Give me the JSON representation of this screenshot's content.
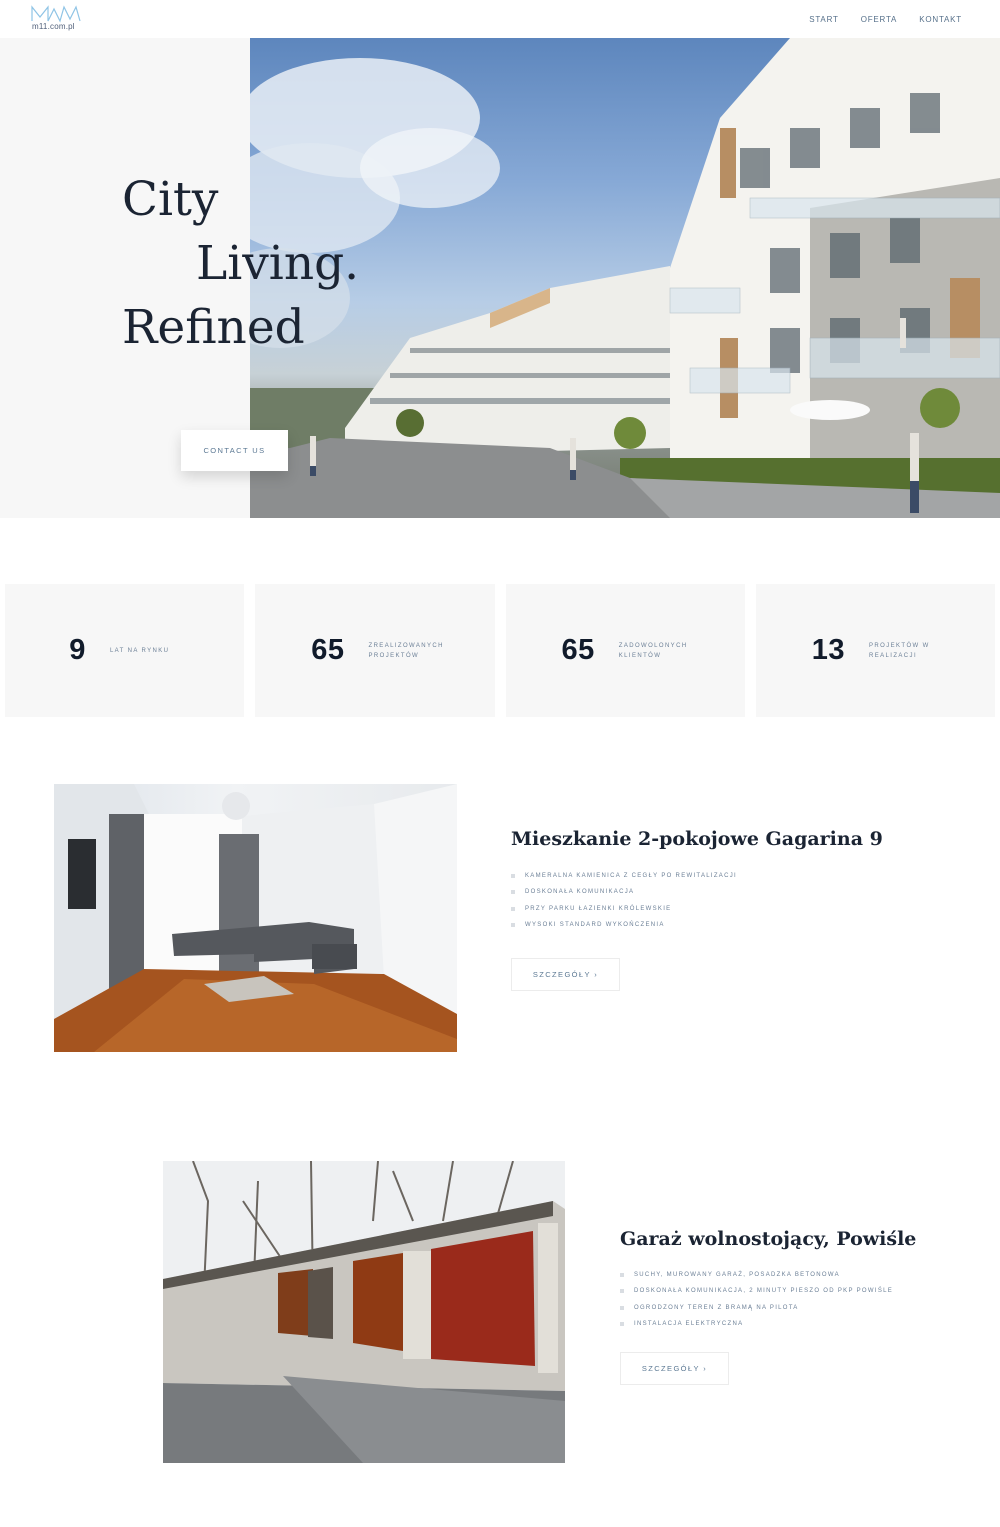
{
  "nav": {
    "logo_text": "m11.com.pl",
    "links": [
      "START",
      "OFERTA",
      "KONTAKT"
    ]
  },
  "hero": {
    "title_line1": "City",
    "title_line2": "Living.",
    "title_line3": "Refined",
    "cta_label": "CONTACT US"
  },
  "stats": [
    {
      "number": "9",
      "label": "LAT NA RYNKU"
    },
    {
      "number": "65",
      "label": "ZREALIZOWANYCH PROJEKTÓW"
    },
    {
      "number": "65",
      "label": "ZADOWOLONYCH KLIENTÓW"
    },
    {
      "number": "13",
      "label": "PROJEKTÓW W REALIZACJI"
    }
  ],
  "offers": [
    {
      "title": "Mieszkanie 2-pokojowe Gagarina 9",
      "features": [
        "KAMERALNA KAMIENICA Z CEGŁY PO REWITALIZACJI",
        "DOSKONAŁA KOMUNIKACJA",
        "PRZY PARKU ŁAZIENKI KRÓLEWSKIE",
        "WYSOKI STANDARD WYKOŃCZENIA"
      ],
      "button_label": "SZCZEGÓŁY ›"
    },
    {
      "title": "Garaż wolnostojący, Powiśle",
      "features": [
        "SUCHY, MUROWANY GARAŻ, POSADZKA BETONOWA",
        "DOSKONAŁA KOMUNIKACJA, 2 MINUTY PIESZO OD PKP POWIŚLE",
        "OGRODZONY TEREN Z BRAMĄ NA PILOTA",
        "INSTALACJA ELEKTRYCZNA"
      ],
      "button_label": "SZCZEGÓŁY ›"
    }
  ]
}
